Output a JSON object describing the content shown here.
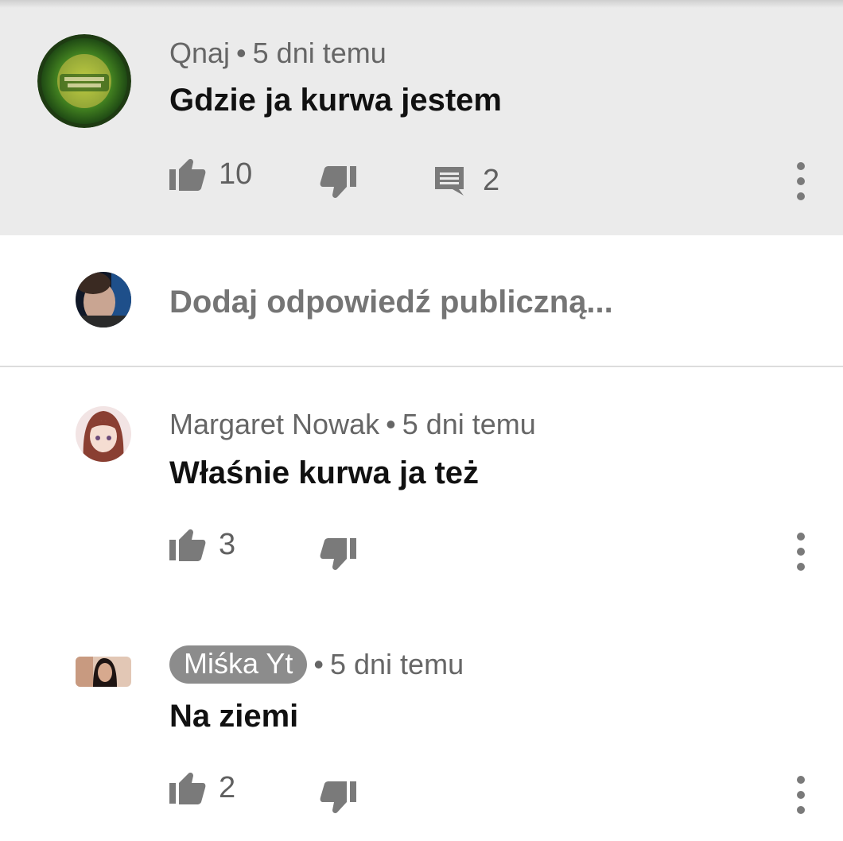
{
  "parent_comment": {
    "author": "Qnaj",
    "separator": "•",
    "time": "5 dni temu",
    "text": "Gdzie ja kurwa jestem",
    "likes": "10",
    "replies": "2"
  },
  "reply_box": {
    "placeholder": "Dodaj odpowiedź publiczną..."
  },
  "replies": [
    {
      "author": "Margaret Nowak",
      "separator": "•",
      "time": "5 dni temu",
      "text": "Właśnie kurwa ja też",
      "likes": "3"
    },
    {
      "author": "Miśka Yt",
      "separator": "•",
      "time": "5 dni temu",
      "text": "Na ziemi",
      "likes": "2"
    }
  ],
  "colors": {
    "parent_bg": "#ebebeb",
    "icon_gray": "#7a7a7a",
    "chip_gray": "#8c8c8c"
  },
  "icons": [
    "thumb-up-icon",
    "thumb-down-icon",
    "comment-icon",
    "more-vert-icon"
  ]
}
